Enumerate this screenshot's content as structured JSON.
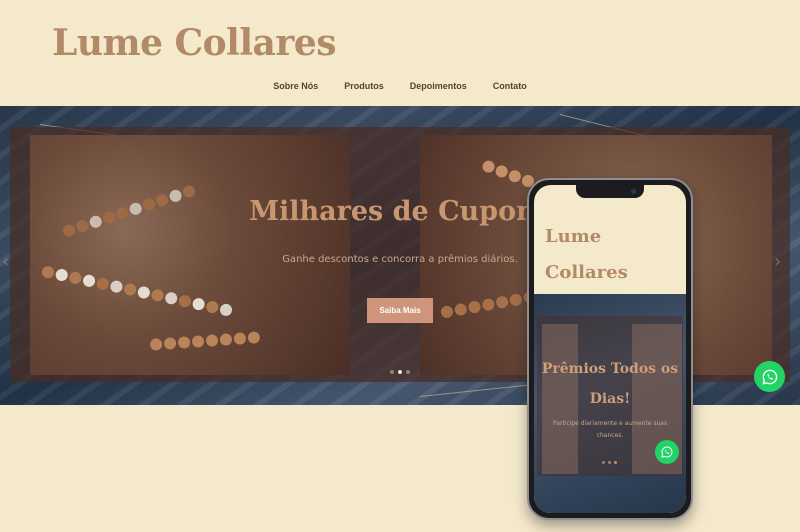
{
  "brand": {
    "name": "Lume Collares"
  },
  "nav": {
    "items": [
      "Sobre Nós",
      "Produtos",
      "Depoimentos",
      "Contato"
    ]
  },
  "hero": {
    "title": "Milhares de Cupons",
    "subtitle": "Ganhe descontos e concorra a prêmios diários.",
    "cta": "Saiba Mais",
    "slides_total": 3,
    "active_slide": 2
  },
  "mobile_preview": {
    "brand": "Lume Collares",
    "slide_title": "Prêmios Todos os Dias!",
    "slide_subtitle": "Participe diariamente e aumente suas chances.",
    "slides_total": 3,
    "active_slide": 3
  },
  "icons": {
    "whatsapp": "whatsapp-icon",
    "prev": "chevron-left-icon",
    "next": "chevron-right-icon"
  },
  "colors": {
    "background": "#f5e9cc",
    "brand": "#b38a68",
    "cta": "#cf947c",
    "whatsapp": "#23d366"
  }
}
